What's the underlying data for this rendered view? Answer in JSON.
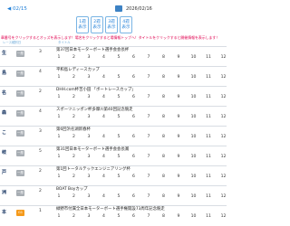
{
  "header": {
    "prev_label": "◀ 02/15",
    "date": "2026/02/16",
    "nav_buttons": [
      {
        "line1": "1週",
        "line2": "表示"
      },
      {
        "line1": "2週",
        "line2": "表示"
      },
      {
        "line1": "3週",
        "line2": "表示"
      },
      {
        "line1": "4週",
        "line2": "表示"
      }
    ],
    "notice": "章番号をクリックするとオッズを表示します！場名をクリックすると場情報トップへ！タイトルをクリックすると開催情報を表示します！"
  },
  "table": {
    "col_series": "レース種別日",
    "col_title": "タイトル"
  },
  "colors": {
    "accent": "#1f7fd8",
    "notice": "#e0004f",
    "badge_gray": "#a7adb3",
    "badge_orange": "#f59a1b"
  },
  "venues": [
    {
      "name": "生",
      "badge": "一般",
      "badge_color": "#a7adb3",
      "day": "3",
      "title": "第37回日本モーターボート選手会会長杯",
      "races": [
        "1",
        "2",
        "3",
        "4",
        "5",
        "6",
        "7",
        "8",
        "9",
        "10",
        "11",
        "12"
      ],
      "dim_from": 1
    },
    {
      "name": "島",
      "badge": "一般",
      "badge_color": "#a7adb3",
      "day": "4",
      "title": "平和島レディースカップ",
      "races": [
        "1",
        "2",
        "3",
        "4",
        "5",
        "6",
        "7",
        "8",
        "9",
        "10",
        "11",
        "12"
      ],
      "dim_from": 1
    },
    {
      "name": "名",
      "badge": "一般",
      "badge_color": "#a7adb3",
      "day": "2",
      "title": "DHH.com杯苦小田 「ボートレースカップ」",
      "races": [
        "1",
        "2",
        "3",
        "4",
        "5",
        "6",
        "7",
        "8",
        "9",
        "10",
        "11",
        "12"
      ],
      "dim_from": 1
    },
    {
      "name": "森",
      "badge": "一般",
      "badge_color": "#a7adb3",
      "day": "4",
      "title": "スポーツニッポン杯多摩川第40回記念競走",
      "races": [
        "1",
        "2",
        "3",
        "4",
        "5",
        "6",
        "7",
        "8",
        "9",
        "10",
        "11",
        "12"
      ],
      "dim_from": 1
    },
    {
      "name": "こ",
      "badge": "一般",
      "badge_color": "#a7adb3",
      "day": "3",
      "title": "第6回浜名湖新春杯",
      "races": [
        "1",
        "2",
        "3",
        "4",
        "5",
        "6",
        "7",
        "8",
        "9",
        "10",
        "11",
        "12"
      ],
      "dim_from": 1
    },
    {
      "name": "岐",
      "badge": "一般",
      "badge_color": "#a7adb3",
      "day": "5",
      "title": "第31回日本モーターボート選手会会長賞",
      "races": [
        "1",
        "2",
        "3",
        "4",
        "5",
        "6",
        "7",
        "8",
        "9",
        "10",
        "11",
        "12"
      ],
      "dim_from": 1
    },
    {
      "name": "戸",
      "badge": "一般",
      "badge_color": "#a7adb3",
      "day": "2",
      "title": "第1回トータルテックエンジニアリング杯",
      "races": [
        "1",
        "2",
        "3",
        "4",
        "5",
        "6",
        "7",
        "8",
        "9",
        "10",
        "11",
        "12"
      ],
      "dim_from": 1
    },
    {
      "name": "洲",
      "badge": "一般",
      "badge_color": "#a7adb3",
      "day": "2",
      "title": "BOAT Boyカップ",
      "races": [
        "1",
        "2",
        "3",
        "4",
        "5",
        "6",
        "7",
        "8",
        "9",
        "10",
        "11",
        "12"
      ],
      "dim_from": 1
    },
    {
      "name": "本",
      "badge": "G1",
      "badge_color": "#f59a1b",
      "day": "1",
      "title": "緑野市付属全日本モーターボート選手権開設73周年記念競走",
      "races": [
        "1",
        "2",
        "3",
        "4",
        "5",
        "6",
        "7",
        "8",
        "9",
        "10",
        "11",
        "12"
      ],
      "dim_from": 1
    }
  ]
}
